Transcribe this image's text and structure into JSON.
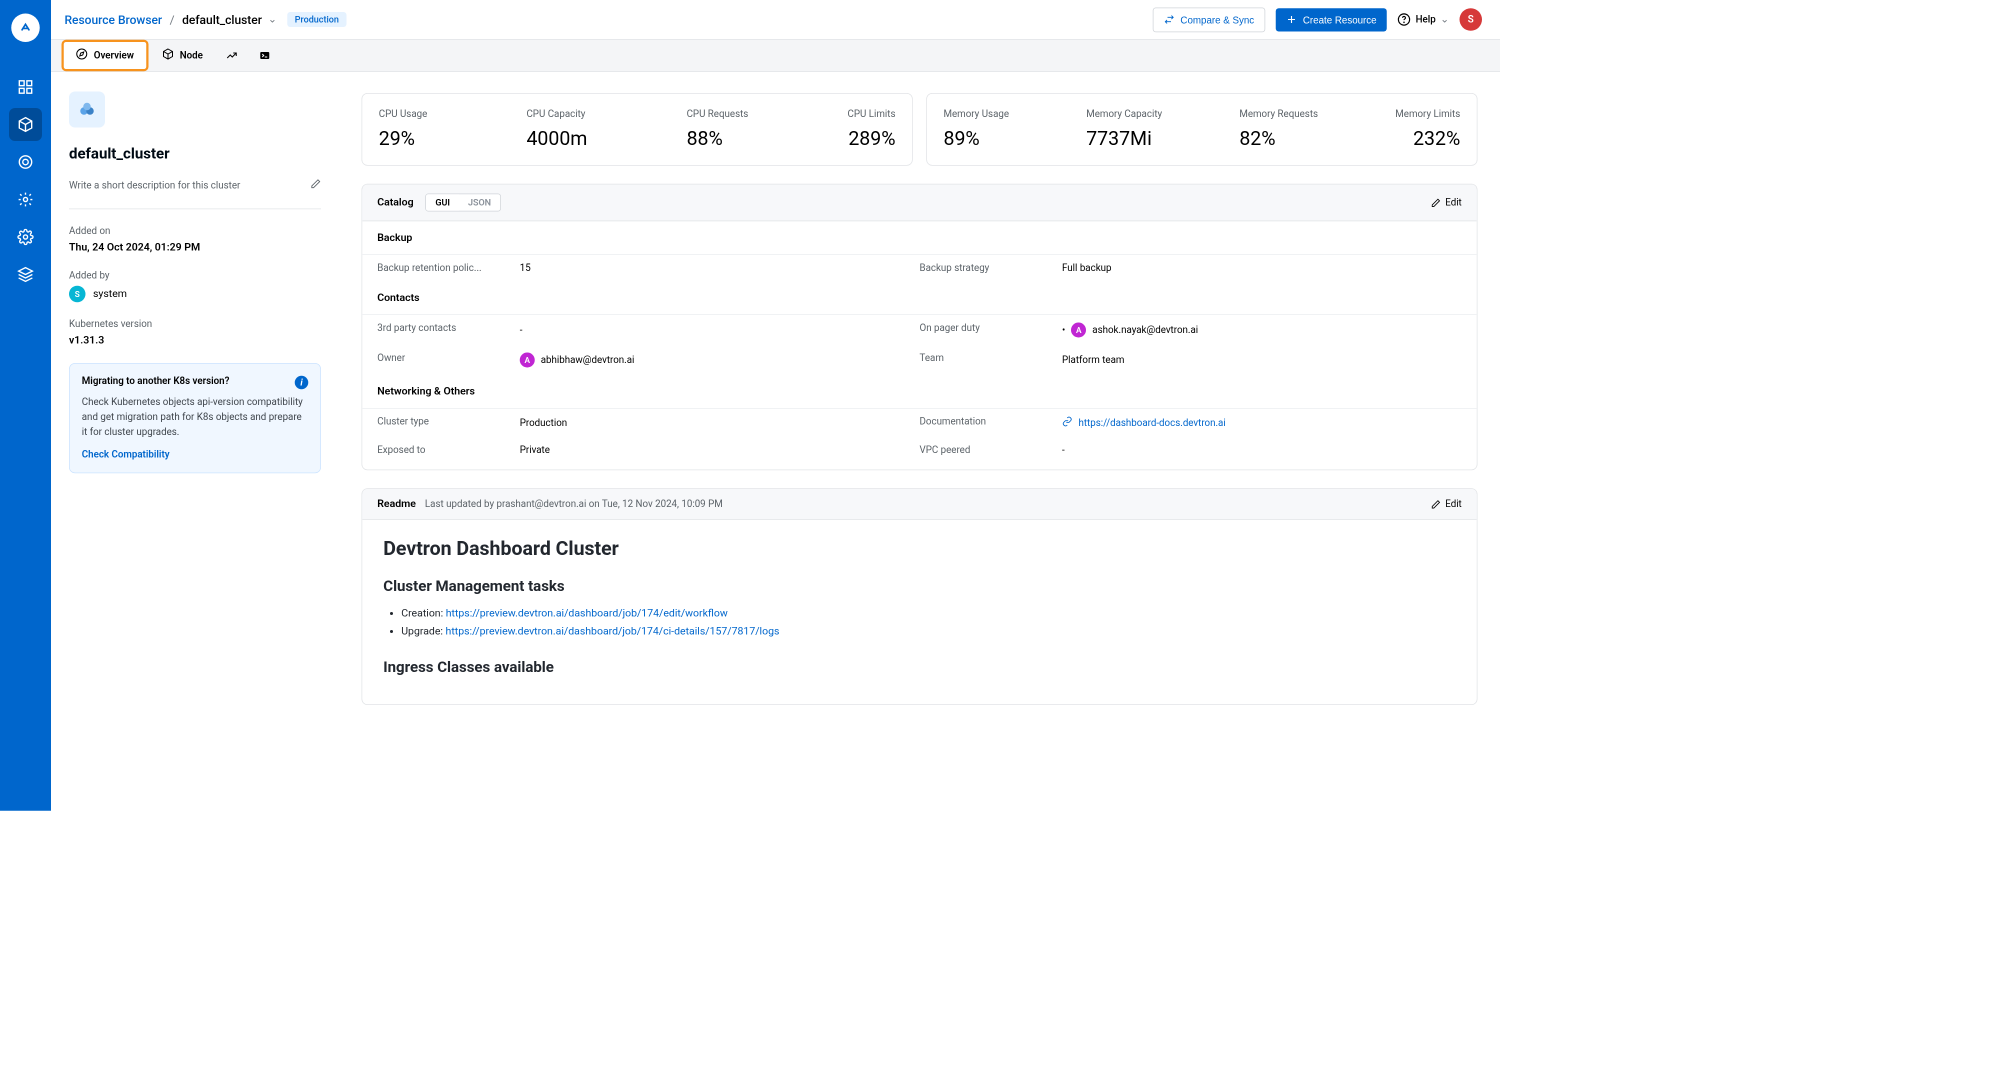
{
  "breadcrumb": {
    "root": "Resource Browser",
    "current": "default_cluster"
  },
  "env_tag": "Production",
  "header": {
    "compare": "Compare & Sync",
    "create": "Create Resource",
    "help": "Help",
    "avatar": "S"
  },
  "tabs": {
    "overview": "Overview",
    "node": "Node"
  },
  "sidebar": {
    "title": "default_cluster",
    "desc_placeholder": "Write a short description for this cluster",
    "added_on_label": "Added on",
    "added_on": "Thu, 24 Oct 2024, 01:29 PM",
    "added_by_label": "Added by",
    "added_by": "system",
    "added_by_initial": "S",
    "k8s_version_label": "Kubernetes version",
    "k8s_version": "v1.31.3",
    "migration": {
      "title": "Migrating to another K8s version?",
      "body": "Check Kubernetes objects api-version compatibility and get migration path for K8s objects and prepare it for cluster upgrades.",
      "cta": "Check Compatibility"
    }
  },
  "metrics": {
    "cpu": [
      {
        "label": "CPU Usage",
        "value": "29%"
      },
      {
        "label": "CPU Capacity",
        "value": "4000m"
      },
      {
        "label": "CPU Requests",
        "value": "88%"
      },
      {
        "label": "CPU Limits",
        "value": "289%"
      }
    ],
    "memory": [
      {
        "label": "Memory Usage",
        "value": "89%"
      },
      {
        "label": "Memory Capacity",
        "value": "7737Mi"
      },
      {
        "label": "Memory Requests",
        "value": "82%"
      },
      {
        "label": "Memory Limits",
        "value": "232%"
      }
    ]
  },
  "catalog": {
    "title": "Catalog",
    "gui": "GUI",
    "json": "JSON",
    "edit": "Edit",
    "backup": {
      "title": "Backup",
      "retention_label": "Backup retention polic...",
      "retention": "15",
      "strategy_label": "Backup strategy",
      "strategy": "Full backup"
    },
    "contacts": {
      "title": "Contacts",
      "third_label": "3rd party contacts",
      "third": "-",
      "pager_label": "On pager duty",
      "pager": "ashok.nayak@devtron.ai",
      "pager_bullet": "•",
      "owner_label": "Owner",
      "owner": "abhibhaw@devtron.ai",
      "team_label": "Team",
      "team": "Platform team"
    },
    "network": {
      "title": "Networking & Others",
      "type_label": "Cluster type",
      "type": "Production",
      "doc_label": "Documentation",
      "doc": "https://dashboard-docs.devtron.ai",
      "exposed_label": "Exposed to",
      "exposed": "Private",
      "vpc_label": "VPC peered",
      "vpc": "-"
    }
  },
  "readme": {
    "title": "Readme",
    "subtitle": "Last updated by prashant@devtron.ai on Tue, 12 Nov 2024, 10:09 PM",
    "edit": "Edit",
    "h1": "Devtron Dashboard Cluster",
    "h2a": "Cluster Management tasks",
    "li1_label": "Creation: ",
    "li1_link": "https://preview.devtron.ai/dashboard/job/174/edit/workflow",
    "li2_label": "Upgrade: ",
    "li2_link": "https://preview.devtron.ai/dashboard/job/174/ci-details/157/7817/logs",
    "h2b": "Ingress Classes available"
  }
}
